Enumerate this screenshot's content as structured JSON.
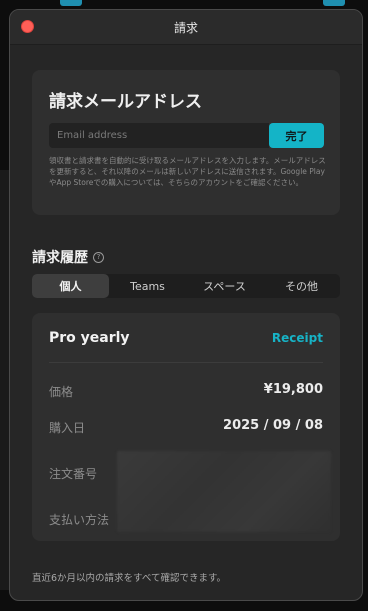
{
  "window": {
    "title": "請求"
  },
  "email_section": {
    "title": "請求メールアドレス",
    "input_placeholder": "Email address",
    "done_label": "完了",
    "description": "領収書と請求書を自動的に受け取るメールアドレスを入力します。メールアドレスを更新すると、それ以降のメールは新しいアドレスに送信されます。Google PlayやApp Storeでの購入については、そちらのアカウントをご確認ください。"
  },
  "history": {
    "title": "請求履歴",
    "help_icon": "question-circle-icon",
    "tabs": [
      {
        "label": "個人",
        "active": true
      },
      {
        "label": "Teams",
        "active": false
      },
      {
        "label": "スペース",
        "active": false
      },
      {
        "label": "その他",
        "active": false
      }
    ],
    "purchase": {
      "plan": "Pro yearly",
      "receipt_label": "Receipt",
      "rows": [
        {
          "label": "価格",
          "value": "¥19,800"
        },
        {
          "label": "購入日",
          "value": "2025 / 09 / 08"
        },
        {
          "label": "注文番号",
          "value": ""
        },
        {
          "label": "支払い方法",
          "value": ""
        }
      ]
    },
    "footer_note": "直近6か月以内の請求をすべて確認できます。"
  },
  "colors": {
    "accent": "#14b4c7",
    "close_button": "#ff5f57",
    "window_bg": "#262626",
    "card_bg": "#2f2f2f"
  }
}
